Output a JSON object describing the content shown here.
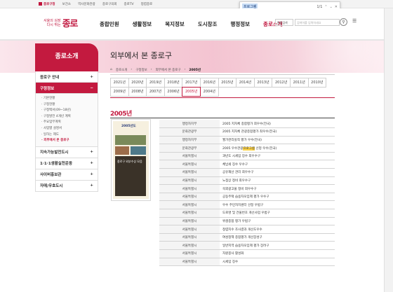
{
  "topbar": {
    "items": [
      "종로구청",
      "보건소",
      "역사문화관광",
      "종로구의회",
      "종로TV",
      "청렴종로"
    ]
  },
  "find": {
    "query": "프로그램",
    "count": "1/1"
  },
  "logo": {
    "line1": "서울의 심장",
    "line2": "다시 뛰는",
    "brand": "종로"
  },
  "gnb": {
    "items": [
      "종합민원",
      "생활정보",
      "복지정보",
      "도시창조",
      "행정정보",
      "종로소개"
    ],
    "active": 5
  },
  "search": {
    "select": "통합검색",
    "placeholder": "검색어를 입력하세요"
  },
  "sidebar": {
    "title": "종로소개",
    "menu1": "종로구 안내",
    "menu2": "구정정보",
    "subs": [
      "기본현황",
      "구정현황",
      "구정백서(09~18년)",
      "구정발전 4개년 계획",
      "주요업무계획",
      "사업별 설명서",
      "일하는 제도",
      "외부에서 본 종로구"
    ],
    "selected": 7,
    "menus": [
      "지속가능발전도시",
      "1·1·1생활실천운동",
      "사이버홍보관",
      "자매/우호도시"
    ]
  },
  "page": {
    "title": "외부에서 본 종로구",
    "breadcrumb": [
      "종로소개",
      "구정정보",
      "외부에서 본 종로구",
      "2005년"
    ]
  },
  "tabs": {
    "row1": [
      "2021년",
      "2020년",
      "2019년",
      "2018년",
      "2017년",
      "2016년",
      "2015년",
      "2014년",
      "2013년",
      "2012년",
      "2011년",
      "2010년"
    ],
    "row2": [
      "2009년",
      "2008년",
      "2007년",
      "2006년",
      "2005년",
      "2004년"
    ],
    "active": "2005년"
  },
  "year_heading": "2005년",
  "book": {
    "title": "2005년도",
    "caption": "종로구 외부수상 모음"
  },
  "awards": [
    {
      "org": "행정자치부",
      "text": "2005 지자체 종합평가 최우수(전국)"
    },
    {
      "org": "문화관광부",
      "text": "2005 지자체 관광종합평가 최우수(전국)"
    },
    {
      "org": "행정자치부",
      "text": "월가관리실적 평가 우수(전국)"
    },
    {
      "org": "문화관광부",
      "text": "2005 우수관광",
      "hl": "프로그램",
      "after": " 선정 우수(전국)"
    },
    {
      "org": "서울특별시",
      "text": "과년도 시세입 징수 최우수구"
    },
    {
      "org": "서울특별시",
      "text": "체납세 징수 우수구"
    },
    {
      "org": "서울특별시",
      "text": "공유재산 관리 최우수구"
    },
    {
      "org": "서울특별시",
      "text": "노점상 정비 최우수구"
    },
    {
      "org": "서울특별시",
      "text": "옥외광고물 정비 최우수구"
    },
    {
      "org": "서울특별시",
      "text": "공동주택 습용자모임제 평가 우수구"
    },
    {
      "org": "서울특별시",
      "text": "우수 주민자치센터 선정 우범구"
    },
    {
      "org": "서울특별시",
      "text": "도로명 및 건물번호 개선사업 우범구"
    },
    {
      "org": "서울특별시",
      "text": "위생종합 평가 우범구"
    },
    {
      "org": "서울특별시",
      "text": "청렴지수 조사결과 개선도우수"
    },
    {
      "org": "서울특별시",
      "text": "여성정책 종합평가 개선장성구"
    },
    {
      "org": "서울특별시",
      "text": "일반지역 습용자모임제 평가 장려구"
    },
    {
      "org": "서울특별시",
      "text": "자원봉사 활성화"
    },
    {
      "org": "서울특별시",
      "text": "시세입 징수"
    }
  ]
}
